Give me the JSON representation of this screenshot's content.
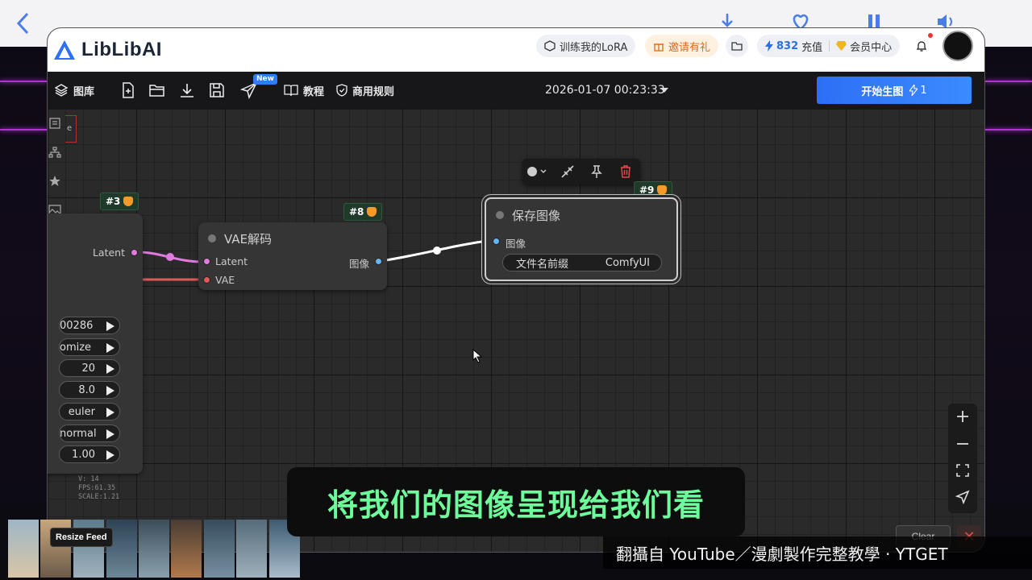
{
  "app": {
    "logo_text": "LibLibAI",
    "colors": {
      "accent_blue": "#2e6ff5",
      "subtitle_green": "#6dfb9c",
      "node_bg": "#353535",
      "link_pink": "#e17adf",
      "link_red": "#e05a5a"
    }
  },
  "header": {
    "train_lora": "训练我的LoRA",
    "invite": "邀请有礼",
    "credits": "832",
    "recharge": "充值",
    "member_center": "会员中心"
  },
  "toolbar": {
    "library": "图库",
    "new_badge": "New",
    "tutorial": "教程",
    "commercial_rules": "商用规则",
    "datetime": "2026-01-07 00:23:33",
    "generate_label": "开始生图",
    "generate_count": "1"
  },
  "canvas": {
    "left_tab": "e",
    "node3": {
      "tag": "#3",
      "output_latent": "Latent",
      "widgets": [
        "00286",
        "omize",
        "20",
        "8.0",
        "euler",
        "normal",
        "1.00"
      ]
    },
    "node8": {
      "tag": "#8",
      "title": "VAE解码",
      "in_latent": "Latent",
      "in_vae": "VAE",
      "out_image": "图像"
    },
    "node9": {
      "tag": "#9",
      "title": "保存图像",
      "in_image": "图像",
      "prefix_label": "文件名前缀",
      "prefix_value": "ComfyUI"
    },
    "stats": {
      "version": "V: 14",
      "fps": "FPS:61.35",
      "scale": "SCALE:1.21"
    }
  },
  "overlay": {
    "resize_feed": "Resize Feed",
    "clear": "Clear",
    "close": "✕",
    "subtitle": "将我们的图像呈现给我们看",
    "source_credit": "翻攝自 YouTube／漫劇製作完整教學 · YTGET"
  }
}
